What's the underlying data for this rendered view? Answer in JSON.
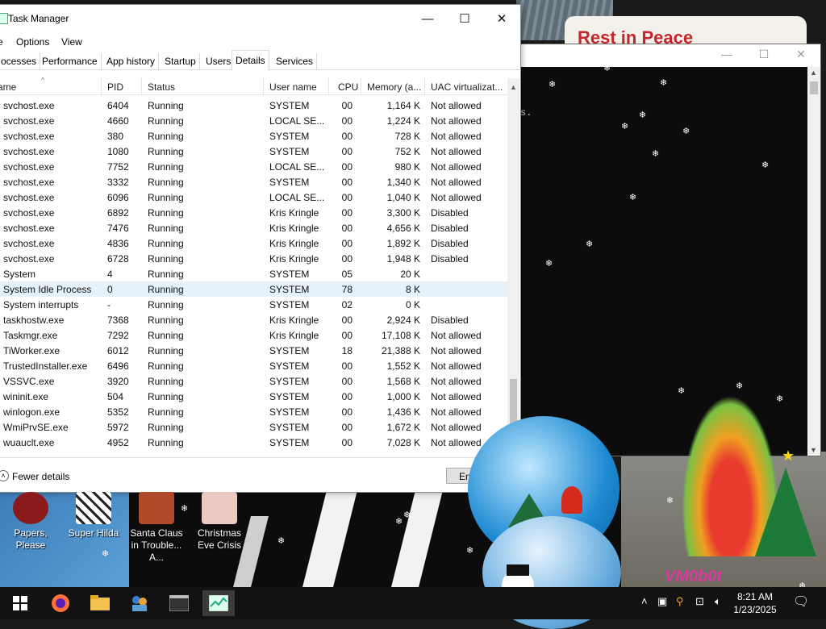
{
  "background": {
    "sign_text": "Rest in Peace"
  },
  "console": {
    "text_fragment": "s.",
    "minimize_glyph": "—",
    "maximize_glyph": "☐",
    "close_glyph": "✕"
  },
  "task_manager": {
    "title": "Task Manager",
    "menu": [
      "e",
      "Options",
      "View"
    ],
    "tabs": [
      "ocesses",
      "Performance",
      "App history",
      "Startup",
      "Users",
      "Details",
      "Services"
    ],
    "active_tab": "Details",
    "columns": [
      "ame",
      "PID",
      "Status",
      "User name",
      "CPU",
      "Memory (a...",
      "UAC virtualizat..."
    ],
    "rows": [
      {
        "name": "svchost.exe",
        "pid": "6404",
        "status": "Running",
        "user": "SYSTEM",
        "cpu": "00",
        "mem": "1,164 K",
        "uac": "Not allowed"
      },
      {
        "name": "svchost.exe",
        "pid": "4660",
        "status": "Running",
        "user": "LOCAL SE...",
        "cpu": "00",
        "mem": "1,224 K",
        "uac": "Not allowed"
      },
      {
        "name": "svchost.exe",
        "pid": "380",
        "status": "Running",
        "user": "SYSTEM",
        "cpu": "00",
        "mem": "728 K",
        "uac": "Not allowed"
      },
      {
        "name": "svchost.exe",
        "pid": "1080",
        "status": "Running",
        "user": "SYSTEM",
        "cpu": "00",
        "mem": "752 K",
        "uac": "Not allowed"
      },
      {
        "name": "svchost.exe",
        "pid": "7752",
        "status": "Running",
        "user": "LOCAL SE...",
        "cpu": "00",
        "mem": "980 K",
        "uac": "Not allowed"
      },
      {
        "name": "svchost.exe",
        "pid": "3332",
        "status": "Running",
        "user": "SYSTEM",
        "cpu": "00",
        "mem": "1,340 K",
        "uac": "Not allowed"
      },
      {
        "name": "svchost.exe",
        "pid": "6096",
        "status": "Running",
        "user": "LOCAL SE...",
        "cpu": "00",
        "mem": "1,040 K",
        "uac": "Not allowed"
      },
      {
        "name": "svchost.exe",
        "pid": "6892",
        "status": "Running",
        "user": "Kris Kringle",
        "cpu": "00",
        "mem": "3,300 K",
        "uac": "Disabled"
      },
      {
        "name": "svchost.exe",
        "pid": "7476",
        "status": "Running",
        "user": "Kris Kringle",
        "cpu": "00",
        "mem": "4,656 K",
        "uac": "Disabled"
      },
      {
        "name": "svchost.exe",
        "pid": "4836",
        "status": "Running",
        "user": "Kris Kringle",
        "cpu": "00",
        "mem": "1,892 K",
        "uac": "Disabled"
      },
      {
        "name": "svchost.exe",
        "pid": "6728",
        "status": "Running",
        "user": "Kris Kringle",
        "cpu": "00",
        "mem": "1,948 K",
        "uac": "Disabled"
      },
      {
        "name": "System",
        "pid": "4",
        "status": "Running",
        "user": "SYSTEM",
        "cpu": "05",
        "mem": "20 K",
        "uac": ""
      },
      {
        "name": "System Idle Process",
        "pid": "0",
        "status": "Running",
        "user": "SYSTEM",
        "cpu": "78",
        "mem": "8 K",
        "uac": ""
      },
      {
        "name": "System interrupts",
        "pid": "-",
        "status": "Running",
        "user": "SYSTEM",
        "cpu": "02",
        "mem": "0 K",
        "uac": ""
      },
      {
        "name": "taskhostw.exe",
        "pid": "7368",
        "status": "Running",
        "user": "Kris Kringle",
        "cpu": "00",
        "mem": "2,924 K",
        "uac": "Disabled"
      },
      {
        "name": "Taskmgr.exe",
        "pid": "7292",
        "status": "Running",
        "user": "Kris Kringle",
        "cpu": "00",
        "mem": "17,108 K",
        "uac": "Not allowed"
      },
      {
        "name": "TiWorker.exe",
        "pid": "6012",
        "status": "Running",
        "user": "SYSTEM",
        "cpu": "18",
        "mem": "21,388 K",
        "uac": "Not allowed"
      },
      {
        "name": "TrustedInstaller.exe",
        "pid": "6496",
        "status": "Running",
        "user": "SYSTEM",
        "cpu": "00",
        "mem": "1,552 K",
        "uac": "Not allowed"
      },
      {
        "name": "VSSVC.exe",
        "pid": "3920",
        "status": "Running",
        "user": "SYSTEM",
        "cpu": "00",
        "mem": "1,568 K",
        "uac": "Not allowed"
      },
      {
        "name": "wininit.exe",
        "pid": "504",
        "status": "Running",
        "user": "SYSTEM",
        "cpu": "00",
        "mem": "1,000 K",
        "uac": "Not allowed"
      },
      {
        "name": "winlogon.exe",
        "pid": "5352",
        "status": "Running",
        "user": "SYSTEM",
        "cpu": "00",
        "mem": "1,436 K",
        "uac": "Not allowed"
      },
      {
        "name": "WmiPrvSE.exe",
        "pid": "5972",
        "status": "Running",
        "user": "SYSTEM",
        "cpu": "00",
        "mem": "1,672 K",
        "uac": "Not allowed"
      },
      {
        "name": "wuauclt.exe",
        "pid": "4952",
        "status": "Running",
        "user": "SYSTEM",
        "cpu": "00",
        "mem": "7,028 K",
        "uac": "Not allowed"
      }
    ],
    "selected_row": 12,
    "fewer_details": "Fewer details",
    "end_task": "En"
  },
  "desktop_icons": [
    {
      "label": "Papers, Please",
      "color": "#8b1a1a"
    },
    {
      "label": "Super Hilda",
      "color": "#e8e8e8"
    },
    {
      "label": "Santa Claus in Trouble... A...",
      "color": "#b04a2a"
    },
    {
      "label": "Christmas Eve Crisis",
      "color": "#d84a4a"
    }
  ],
  "decor": {
    "watermark": "VM0b0t"
  },
  "taskbar": {
    "time": "8:21 AM",
    "date": "1/23/2025"
  }
}
